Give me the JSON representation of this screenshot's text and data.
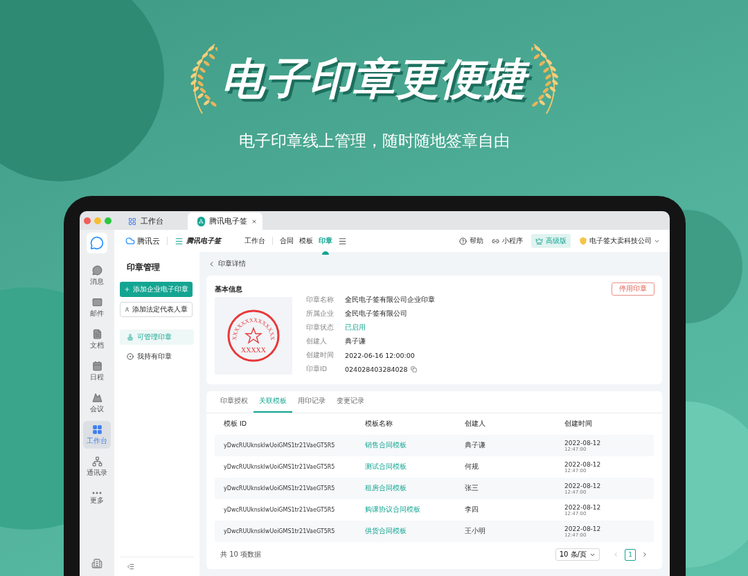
{
  "banner": {
    "title": "电子印章更便捷",
    "subtitle": "电子印章线上管理，随时随地签章自由"
  },
  "window_tabs": [
    {
      "label": "工作台",
      "selected": false
    },
    {
      "label": "腾讯电子签",
      "selected": true
    }
  ],
  "rail": {
    "items": [
      {
        "label": "消息",
        "selected": false
      },
      {
        "label": "邮件",
        "selected": false
      },
      {
        "label": "文档",
        "selected": false
      },
      {
        "label": "日程",
        "selected": false
      },
      {
        "label": "会议",
        "selected": false
      },
      {
        "label": "工作台",
        "selected": true
      },
      {
        "label": "通讯录",
        "selected": false
      },
      {
        "label": "更多",
        "selected": false
      }
    ]
  },
  "top_nav": {
    "brand": "腾讯云",
    "product": "腾讯电子签",
    "links": [
      {
        "label": "工作台",
        "selected": false
      },
      {
        "label": "合同",
        "selected": false
      },
      {
        "label": "模板",
        "selected": false
      },
      {
        "label": "印章",
        "selected": true
      }
    ],
    "help": "帮助",
    "mini_program": "小程序",
    "plan": "高级版",
    "company": "电子签大卖科技公司"
  },
  "side_panel": {
    "title": "印章管理",
    "primary_button": "添加企业电子印章",
    "secondary_button": "添加法定代表人章",
    "items": [
      {
        "label": "可管理印章",
        "selected": true
      },
      {
        "label": "我持有印章",
        "selected": false
      }
    ]
  },
  "detail": {
    "back": "印章详情",
    "section_title": "基本信息",
    "disable_button": "停用印章",
    "seal": {
      "arc_text": "XXXXXXXXXXXXXX",
      "bottom_text": "XXXXX"
    },
    "fields": [
      {
        "label": "印章名称",
        "value": "全民电子签有限公司企业印章",
        "kind": "text"
      },
      {
        "label": "所属企业",
        "value": "全民电子签有限公司",
        "kind": "text"
      },
      {
        "label": "印章状态",
        "value": "已启用",
        "kind": "status"
      },
      {
        "label": "创建人",
        "value": "典子谦",
        "kind": "text"
      },
      {
        "label": "创建时间",
        "value": "2022-06-16 12:00:00",
        "kind": "text"
      },
      {
        "label": "印章ID",
        "value": "024028403284028",
        "kind": "copy"
      }
    ]
  },
  "tabs": [
    {
      "label": "印章授权",
      "selected": false
    },
    {
      "label": "关联模板",
      "selected": true
    },
    {
      "label": "用印记录",
      "selected": false
    },
    {
      "label": "变更记录",
      "selected": false
    }
  ],
  "table": {
    "columns": [
      "模板 ID",
      "模板名称",
      "创建人",
      "创建时间"
    ],
    "rows": [
      {
        "id": "yDwcRUUknsklwUoiGMS1tr21VaeGT5R5",
        "name": "销售合同模板",
        "creator": "典子谦",
        "date": "2022-08-12",
        "time": "12:47:00"
      },
      {
        "id": "yDwcRUUknsklwUoiGMS1tr21VaeGT5R5",
        "name": "测试合同模板",
        "creator": "何规",
        "date": "2022-08-12",
        "time": "12:47:00"
      },
      {
        "id": "yDwcRUUknsklwUoiGMS1tr21VaeGT5R5",
        "name": "租房合同模板",
        "creator": "张三",
        "date": "2022-08-12",
        "time": "12:47:00"
      },
      {
        "id": "yDwcRUUknsklwUoiGMS1tr21VaeGT5R5",
        "name": "购课协议合同模板",
        "creator": "李四",
        "date": "2022-08-12",
        "time": "12:47:00"
      },
      {
        "id": "yDwcRUUknsklwUoiGMS1tr21VaeGT5R5",
        "name": "供货合同模板",
        "creator": "王小明",
        "date": "2022-08-12",
        "time": "12:47:00"
      }
    ]
  },
  "footer": {
    "total": "共 10 项数据",
    "page_size": "10 条/页",
    "pages": [
      {
        "label": "1",
        "selected": true
      }
    ]
  }
}
